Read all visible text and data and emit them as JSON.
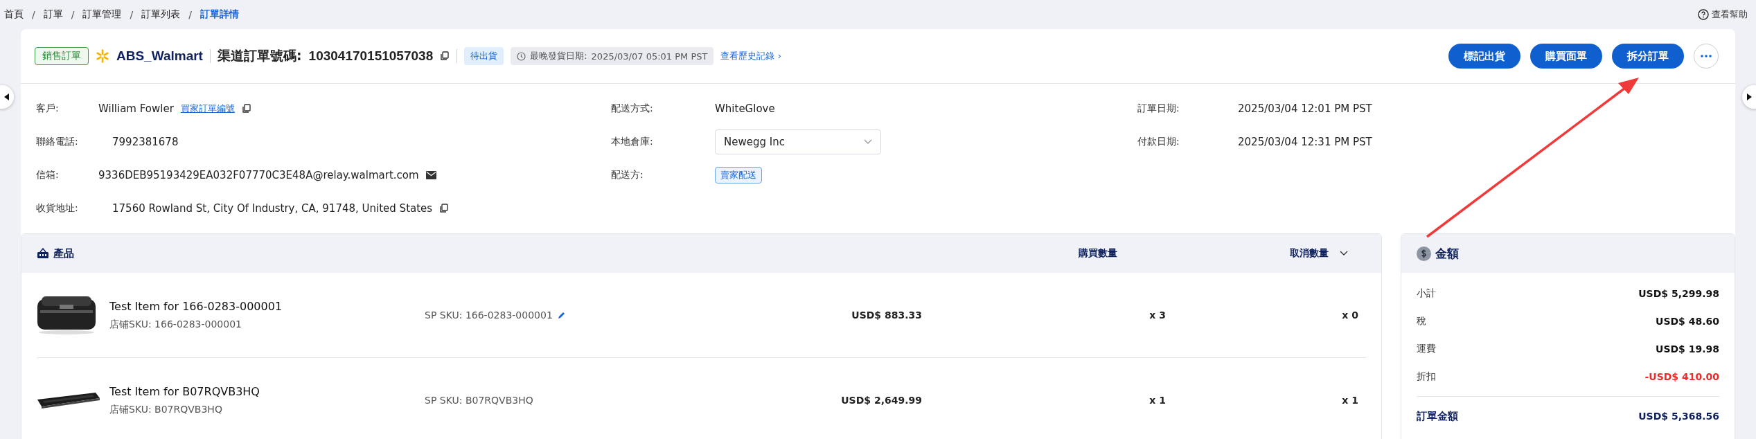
{
  "breadcrumb": [
    {
      "label": "首頁",
      "selected": false
    },
    {
      "label": "訂單",
      "selected": false
    },
    {
      "label": "訂單管理",
      "selected": false
    },
    {
      "label": "訂單列表",
      "selected": false
    },
    {
      "label": "訂單詳情",
      "selected": true
    }
  ],
  "breadcrumb_separator": "/",
  "help_link": "查看幫助",
  "header": {
    "order_type": "銷售訂單",
    "store": "ABS_Walmart",
    "channel_order_label": "渠道訂單號碼:",
    "channel_order_number": "10304170151057038",
    "status": "待出貨",
    "deadline_label": "最晚發貨日期:",
    "deadline": "2025/03/07 05:01 PM PST",
    "history_link": "查看歷史記錄",
    "history_arrow": "›"
  },
  "actions": [
    {
      "label": "標記出貨"
    },
    {
      "label": "購買面單"
    },
    {
      "label": "拆分訂單"
    }
  ],
  "info_left": [
    {
      "kind": "customer",
      "label": "客戶:",
      "value": "William Fowler",
      "link": "買家訂單編號"
    },
    {
      "kind": "text",
      "label": "聯絡電話:",
      "value": "7992381678"
    },
    {
      "kind": "email",
      "label": "信箱:",
      "value": "9336DEB95193429EA032F07770C3E48A@relay.walmart.com"
    },
    {
      "kind": "address",
      "label": "收貨地址:",
      "value": "17560 Rowland St, City Of Industry, CA, 91748, United States"
    }
  ],
  "info_middle": [
    {
      "kind": "text",
      "label": "配送方式:",
      "value": "WhiteGlove"
    },
    {
      "kind": "select",
      "label": "本地倉庫:",
      "value": "Newegg Inc"
    },
    {
      "kind": "tag",
      "label": "配送方:",
      "value": "賣家配送"
    }
  ],
  "info_right": [
    {
      "label": "訂單日期:",
      "value": "2025/03/04 12:01 PM PST"
    },
    {
      "label": "付款日期:",
      "value": "2025/03/04 12:31 PM PST"
    }
  ],
  "products": {
    "title": "產品",
    "columns": [
      "購買數量",
      "取消數量"
    ],
    "rows": [
      {
        "kind": "case",
        "name": "Test Item for 166-0283-000001",
        "store_sku": "店铺SKU: 166-0283-000001",
        "sp_sku": "SP SKU: 166-0283-000001",
        "editable": true,
        "price": "USD$ 883.33",
        "qty": "x 3",
        "cancel": "x 0"
      },
      {
        "kind": "keyboard",
        "name": "Test Item for B07RQVB3HQ",
        "store_sku": "店铺SKU: B07RQVB3HQ",
        "sp_sku": "SP SKU: B07RQVB3HQ",
        "editable": false,
        "price": "USD$ 2,649.99",
        "qty": "x 1",
        "cancel": "x 1"
      }
    ]
  },
  "amounts": {
    "title": "金額",
    "lines": [
      {
        "kind": "normal",
        "label": "小計",
        "value": "USD$ 5,299.98"
      },
      {
        "kind": "normal",
        "label": "稅",
        "value": "USD$ 48.60"
      },
      {
        "kind": "normal",
        "label": "運費",
        "value": "USD$ 19.98"
      },
      {
        "kind": "discount",
        "label": "折扣",
        "value": "-USD$ 410.00"
      },
      {
        "kind": "total",
        "label": "訂單金額",
        "value": "USD$ 5,368.56"
      }
    ]
  },
  "annotation": {
    "kind": "arrow"
  }
}
